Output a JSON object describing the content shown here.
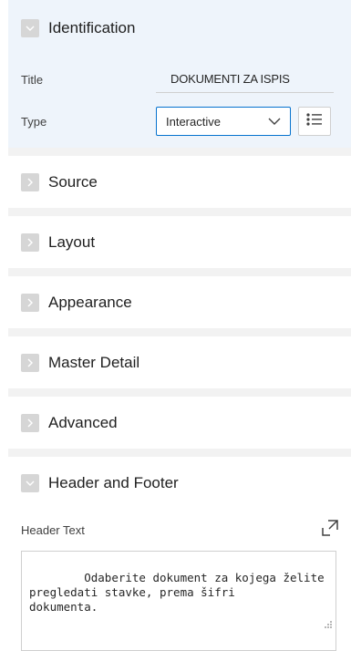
{
  "sections": {
    "identification": {
      "title": "Identification",
      "fields": {
        "title_label": "Title",
        "title_value": "DOKUMENTI ZA ISPIS",
        "type_label": "Type",
        "type_value": "Interactive"
      }
    },
    "source": {
      "title": "Source"
    },
    "layout": {
      "title": "Layout"
    },
    "appearance": {
      "title": "Appearance"
    },
    "master_detail": {
      "title": "Master Detail"
    },
    "advanced": {
      "title": "Advanced"
    },
    "header_footer": {
      "title": "Header and Footer",
      "header_text_label": "Header Text",
      "header_text_value": "Odaberite dokument za kojega želite\npregledati stavke, prema šifri\ndokumenta."
    }
  },
  "icons": {
    "expanded": "chevron-down-icon",
    "collapsed": "chevron-right-icon",
    "list": "list-icon",
    "expand_editor": "expand-editor-icon",
    "resize": "resize-grip-icon"
  },
  "colors": {
    "accent_border": "#0572ce",
    "header_tint": "#eef4fb",
    "toggle_bg": "#d6d6d6"
  }
}
